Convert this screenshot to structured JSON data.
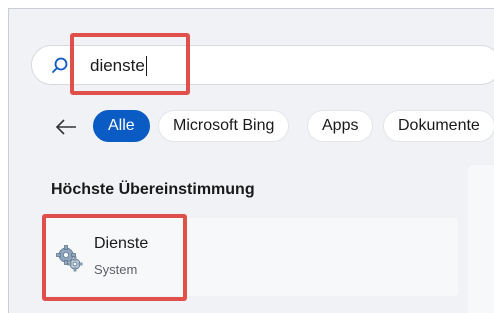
{
  "search": {
    "value": "dienste"
  },
  "filters": [
    {
      "label": "Alle",
      "active": true
    },
    {
      "label": "Microsoft Bing",
      "active": false
    },
    {
      "label": "Apps",
      "active": false
    },
    {
      "label": "Dokumente",
      "active": false
    }
  ],
  "best_match": {
    "heading": "Höchste Übereinstimmung",
    "title": "Dienste",
    "subtitle": "System",
    "icon": "gears-icon"
  },
  "colors": {
    "accent": "#0a5bc4",
    "highlight": "#e0504b"
  }
}
